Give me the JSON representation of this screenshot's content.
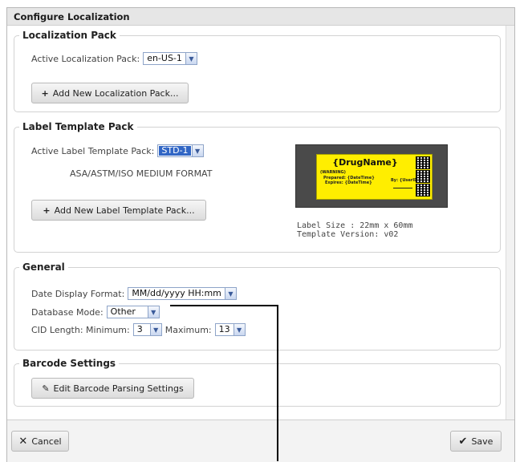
{
  "dialog": {
    "title": "Configure Localization",
    "cancel_label": "Cancel",
    "save_label": "Save"
  },
  "localization": {
    "legend": "Localization Pack",
    "active_label": "Active Localization Pack:",
    "active_value": "en-US-1",
    "add_button": "Add New Localization Pack..."
  },
  "label_template": {
    "legend": "Label Template Pack",
    "active_label": "Active Label Template Pack:",
    "active_value": "STD-1",
    "format_name": "ASA/ASTM/ISO MEDIUM FORMAT",
    "add_button": "Add New Label Template Pack...",
    "preview": {
      "drug_name": "{DrugName}",
      "warning": "(WARNING)",
      "prepared": "Prepared: {DateTime}",
      "expires": "Expires: {DateTime}",
      "by": "By: {UserID}",
      "label_color": "#ffee00"
    },
    "label_size": "Label Size :  22mm x 60mm",
    "template_version": "Template Version:  v02"
  },
  "general": {
    "legend": "General",
    "date_format_label": "Date Display Format:",
    "date_format_value": "MM/dd/yyyy HH:mm",
    "db_mode_label": "Database Mode:",
    "db_mode_value": "Other",
    "cid_label": "CID Length: Minimum:",
    "cid_min": "3",
    "cid_max_label": "Maximum:",
    "cid_max": "13"
  },
  "barcode": {
    "legend": "Barcode Settings",
    "edit_button": "Edit Barcode Parsing Settings"
  },
  "icons": {
    "add": "plus-icon",
    "edit": "pencil-icon",
    "cancel": "x-icon",
    "save": "checkmark-icon",
    "dropdown": "chevron-down-icon"
  },
  "colors": {
    "accent_select": "#3166c5",
    "title_bar": "#e6e6e6"
  }
}
